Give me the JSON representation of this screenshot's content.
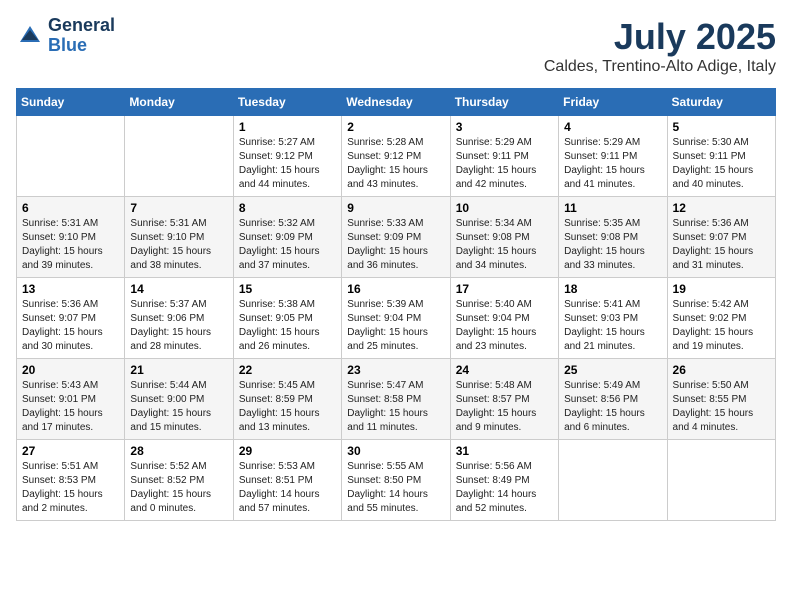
{
  "logo": {
    "line1": "General",
    "line2": "Blue"
  },
  "title": "July 2025",
  "subtitle": "Caldes, Trentino-Alto Adige, Italy",
  "header": {
    "days": [
      "Sunday",
      "Monday",
      "Tuesday",
      "Wednesday",
      "Thursday",
      "Friday",
      "Saturday"
    ]
  },
  "weeks": [
    [
      {
        "day": "",
        "info": ""
      },
      {
        "day": "",
        "info": ""
      },
      {
        "day": "1",
        "info": "Sunrise: 5:27 AM\nSunset: 9:12 PM\nDaylight: 15 hours\nand 44 minutes."
      },
      {
        "day": "2",
        "info": "Sunrise: 5:28 AM\nSunset: 9:12 PM\nDaylight: 15 hours\nand 43 minutes."
      },
      {
        "day": "3",
        "info": "Sunrise: 5:29 AM\nSunset: 9:11 PM\nDaylight: 15 hours\nand 42 minutes."
      },
      {
        "day": "4",
        "info": "Sunrise: 5:29 AM\nSunset: 9:11 PM\nDaylight: 15 hours\nand 41 minutes."
      },
      {
        "day": "5",
        "info": "Sunrise: 5:30 AM\nSunset: 9:11 PM\nDaylight: 15 hours\nand 40 minutes."
      }
    ],
    [
      {
        "day": "6",
        "info": "Sunrise: 5:31 AM\nSunset: 9:10 PM\nDaylight: 15 hours\nand 39 minutes."
      },
      {
        "day": "7",
        "info": "Sunrise: 5:31 AM\nSunset: 9:10 PM\nDaylight: 15 hours\nand 38 minutes."
      },
      {
        "day": "8",
        "info": "Sunrise: 5:32 AM\nSunset: 9:09 PM\nDaylight: 15 hours\nand 37 minutes."
      },
      {
        "day": "9",
        "info": "Sunrise: 5:33 AM\nSunset: 9:09 PM\nDaylight: 15 hours\nand 36 minutes."
      },
      {
        "day": "10",
        "info": "Sunrise: 5:34 AM\nSunset: 9:08 PM\nDaylight: 15 hours\nand 34 minutes."
      },
      {
        "day": "11",
        "info": "Sunrise: 5:35 AM\nSunset: 9:08 PM\nDaylight: 15 hours\nand 33 minutes."
      },
      {
        "day": "12",
        "info": "Sunrise: 5:36 AM\nSunset: 9:07 PM\nDaylight: 15 hours\nand 31 minutes."
      }
    ],
    [
      {
        "day": "13",
        "info": "Sunrise: 5:36 AM\nSunset: 9:07 PM\nDaylight: 15 hours\nand 30 minutes."
      },
      {
        "day": "14",
        "info": "Sunrise: 5:37 AM\nSunset: 9:06 PM\nDaylight: 15 hours\nand 28 minutes."
      },
      {
        "day": "15",
        "info": "Sunrise: 5:38 AM\nSunset: 9:05 PM\nDaylight: 15 hours\nand 26 minutes."
      },
      {
        "day": "16",
        "info": "Sunrise: 5:39 AM\nSunset: 9:04 PM\nDaylight: 15 hours\nand 25 minutes."
      },
      {
        "day": "17",
        "info": "Sunrise: 5:40 AM\nSunset: 9:04 PM\nDaylight: 15 hours\nand 23 minutes."
      },
      {
        "day": "18",
        "info": "Sunrise: 5:41 AM\nSunset: 9:03 PM\nDaylight: 15 hours\nand 21 minutes."
      },
      {
        "day": "19",
        "info": "Sunrise: 5:42 AM\nSunset: 9:02 PM\nDaylight: 15 hours\nand 19 minutes."
      }
    ],
    [
      {
        "day": "20",
        "info": "Sunrise: 5:43 AM\nSunset: 9:01 PM\nDaylight: 15 hours\nand 17 minutes."
      },
      {
        "day": "21",
        "info": "Sunrise: 5:44 AM\nSunset: 9:00 PM\nDaylight: 15 hours\nand 15 minutes."
      },
      {
        "day": "22",
        "info": "Sunrise: 5:45 AM\nSunset: 8:59 PM\nDaylight: 15 hours\nand 13 minutes."
      },
      {
        "day": "23",
        "info": "Sunrise: 5:47 AM\nSunset: 8:58 PM\nDaylight: 15 hours\nand 11 minutes."
      },
      {
        "day": "24",
        "info": "Sunrise: 5:48 AM\nSunset: 8:57 PM\nDaylight: 15 hours\nand 9 minutes."
      },
      {
        "day": "25",
        "info": "Sunrise: 5:49 AM\nSunset: 8:56 PM\nDaylight: 15 hours\nand 6 minutes."
      },
      {
        "day": "26",
        "info": "Sunrise: 5:50 AM\nSunset: 8:55 PM\nDaylight: 15 hours\nand 4 minutes."
      }
    ],
    [
      {
        "day": "27",
        "info": "Sunrise: 5:51 AM\nSunset: 8:53 PM\nDaylight: 15 hours\nand 2 minutes."
      },
      {
        "day": "28",
        "info": "Sunrise: 5:52 AM\nSunset: 8:52 PM\nDaylight: 15 hours\nand 0 minutes."
      },
      {
        "day": "29",
        "info": "Sunrise: 5:53 AM\nSunset: 8:51 PM\nDaylight: 14 hours\nand 57 minutes."
      },
      {
        "day": "30",
        "info": "Sunrise: 5:55 AM\nSunset: 8:50 PM\nDaylight: 14 hours\nand 55 minutes."
      },
      {
        "day": "31",
        "info": "Sunrise: 5:56 AM\nSunset: 8:49 PM\nDaylight: 14 hours\nand 52 minutes."
      },
      {
        "day": "",
        "info": ""
      },
      {
        "day": "",
        "info": ""
      }
    ]
  ]
}
